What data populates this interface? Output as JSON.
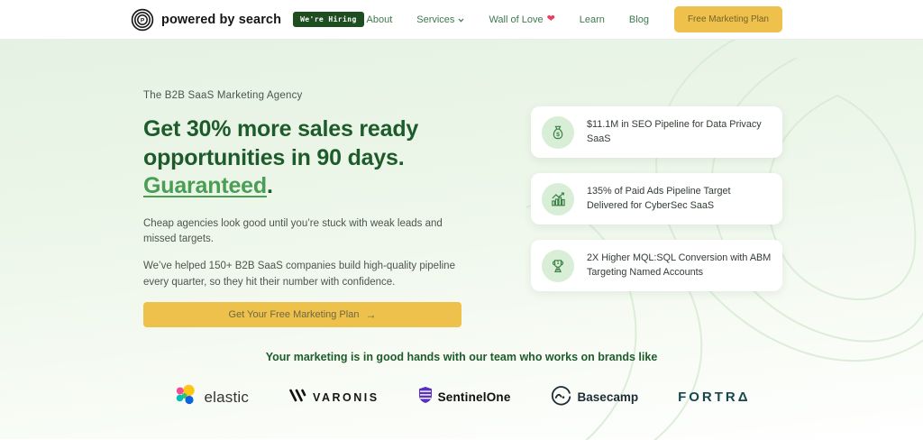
{
  "header": {
    "brand": "powered by search",
    "hiring_badge": "We're Hiring",
    "nav": [
      {
        "label": "About"
      },
      {
        "label": "Services"
      },
      {
        "label": "Wall of Love"
      },
      {
        "label": "Learn"
      },
      {
        "label": "Blog"
      }
    ],
    "cta_label": "Free Marketing Plan"
  },
  "hero": {
    "eyebrow": "The B2B SaaS Marketing Agency",
    "heading": {
      "line1": "Get 30% more sales ready",
      "line2": "opportunities in 90 days.",
      "link": "Guaranteed",
      "period": "."
    },
    "paragraph1": "Cheap agencies look good until you’re stuck with weak leads and missed targets.",
    "paragraph2": "We’ve helped 150+ B2B SaaS companies build high-quality pipeline every quarter, so they hit their number with confidence.",
    "cta_label": "Get Your Free Marketing Plan",
    "cta_arrow": "→"
  },
  "result_cards": [
    {
      "icon": "money-bag-icon",
      "text": "$11.1M in SEO Pipeline for Data Privacy SaaS"
    },
    {
      "icon": "bar-chart-icon",
      "text": "135% of Paid Ads Pipeline Target Delivered for CyberSec SaaS"
    },
    {
      "icon": "trophy-icon",
      "text": "2X Higher MQL:SQL Conversion with ABM Targeting Named Accounts"
    }
  ],
  "brands": {
    "heading": "Your marketing is in good hands with our team who works on brands like",
    "logos": [
      {
        "name": "elastic",
        "text": "elastic"
      },
      {
        "name": "varonis",
        "text": "VARONIS"
      },
      {
        "name": "sentinelone",
        "text": "SentinelOne"
      },
      {
        "name": "basecamp",
        "text": "Basecamp"
      },
      {
        "name": "fortra",
        "text": "FORTR",
        "suffix": "Δ"
      }
    ]
  },
  "icons": {
    "heart": "❤"
  },
  "colors": {
    "accent_green": "#1d5c2a",
    "link_green": "#4a9e53",
    "nav_green": "#3e7a4d",
    "gold": "#edc14b",
    "heart_pink": "#ee3a5e",
    "badge_green": "#1e4d1f",
    "card_icon_bg": "#d9eed6"
  }
}
